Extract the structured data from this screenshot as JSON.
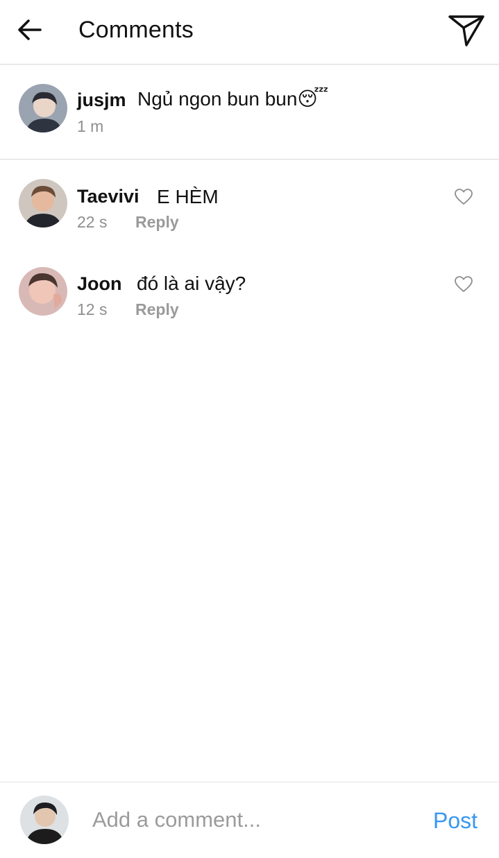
{
  "header": {
    "title": "Comments",
    "back_icon": "arrow-left-icon",
    "send_icon": "paper-plane-icon"
  },
  "caption": {
    "username": "jusjm",
    "text": "Ngủ ngon bun bun😴",
    "time": "1 m"
  },
  "comments": [
    {
      "username": "Taevivi",
      "text": "E HÈM",
      "time": "22 s",
      "reply_label": "Reply",
      "like_icon": "heart-outline-icon"
    },
    {
      "username": "Joon",
      "text": "đó là ai vậy?",
      "time": "12 s",
      "reply_label": "Reply",
      "like_icon": "heart-outline-icon"
    }
  ],
  "composer": {
    "placeholder": "Add a comment...",
    "post_label": "Post"
  },
  "colors": {
    "accent": "#3897f0",
    "muted_text": "#8e8e8e",
    "divider": "#dadada"
  }
}
